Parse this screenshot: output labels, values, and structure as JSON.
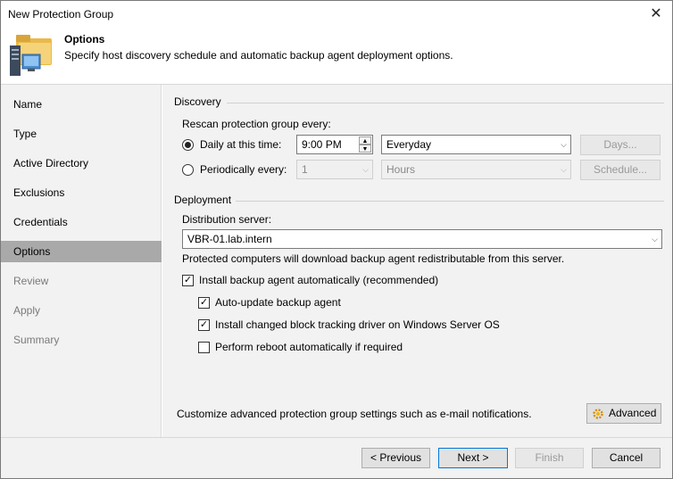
{
  "window": {
    "title": "New Protection Group",
    "close_glyph": "✕"
  },
  "header": {
    "title": "Options",
    "description": "Specify host discovery schedule and automatic backup agent deployment options.",
    "icon": "protection-group-wizard-icon"
  },
  "sidebar": {
    "items": [
      {
        "label": "Name",
        "state": "normal"
      },
      {
        "label": "Type",
        "state": "normal"
      },
      {
        "label": "Active Directory",
        "state": "normal"
      },
      {
        "label": "Exclusions",
        "state": "normal"
      },
      {
        "label": "Credentials",
        "state": "normal"
      },
      {
        "label": "Options",
        "state": "active"
      },
      {
        "label": "Review",
        "state": "disabled"
      },
      {
        "label": "Apply",
        "state": "disabled"
      },
      {
        "label": "Summary",
        "state": "disabled"
      }
    ]
  },
  "discovery": {
    "section_label": "Discovery",
    "rescan_label": "Rescan protection group every:",
    "daily_label": "Daily at this time:",
    "daily_time": "9:00 PM",
    "daily_frequency": "Everyday",
    "days_button": "Days...",
    "periodic_label": "Periodically every:",
    "periodic_value": "1",
    "periodic_unit": "Hours",
    "schedule_button": "Schedule..."
  },
  "deployment": {
    "section_label": "Deployment",
    "distribution_label": "Distribution server:",
    "distribution_value": "VBR-01.lab.intern",
    "distribution_note": "Protected computers will download backup agent redistributable from this server.",
    "install_label": "Install backup agent automatically (recommended)",
    "auto_update_label": "Auto-update backup agent",
    "cbt_label": "Install changed block tracking driver on Windows Server OS",
    "reboot_label": "Perform reboot automatically if required"
  },
  "advanced": {
    "text": "Customize advanced protection group settings such as e-mail notifications.",
    "button": "Advanced"
  },
  "footer": {
    "previous": "< Previous",
    "next": "Next >",
    "finish": "Finish",
    "cancel": "Cancel"
  }
}
